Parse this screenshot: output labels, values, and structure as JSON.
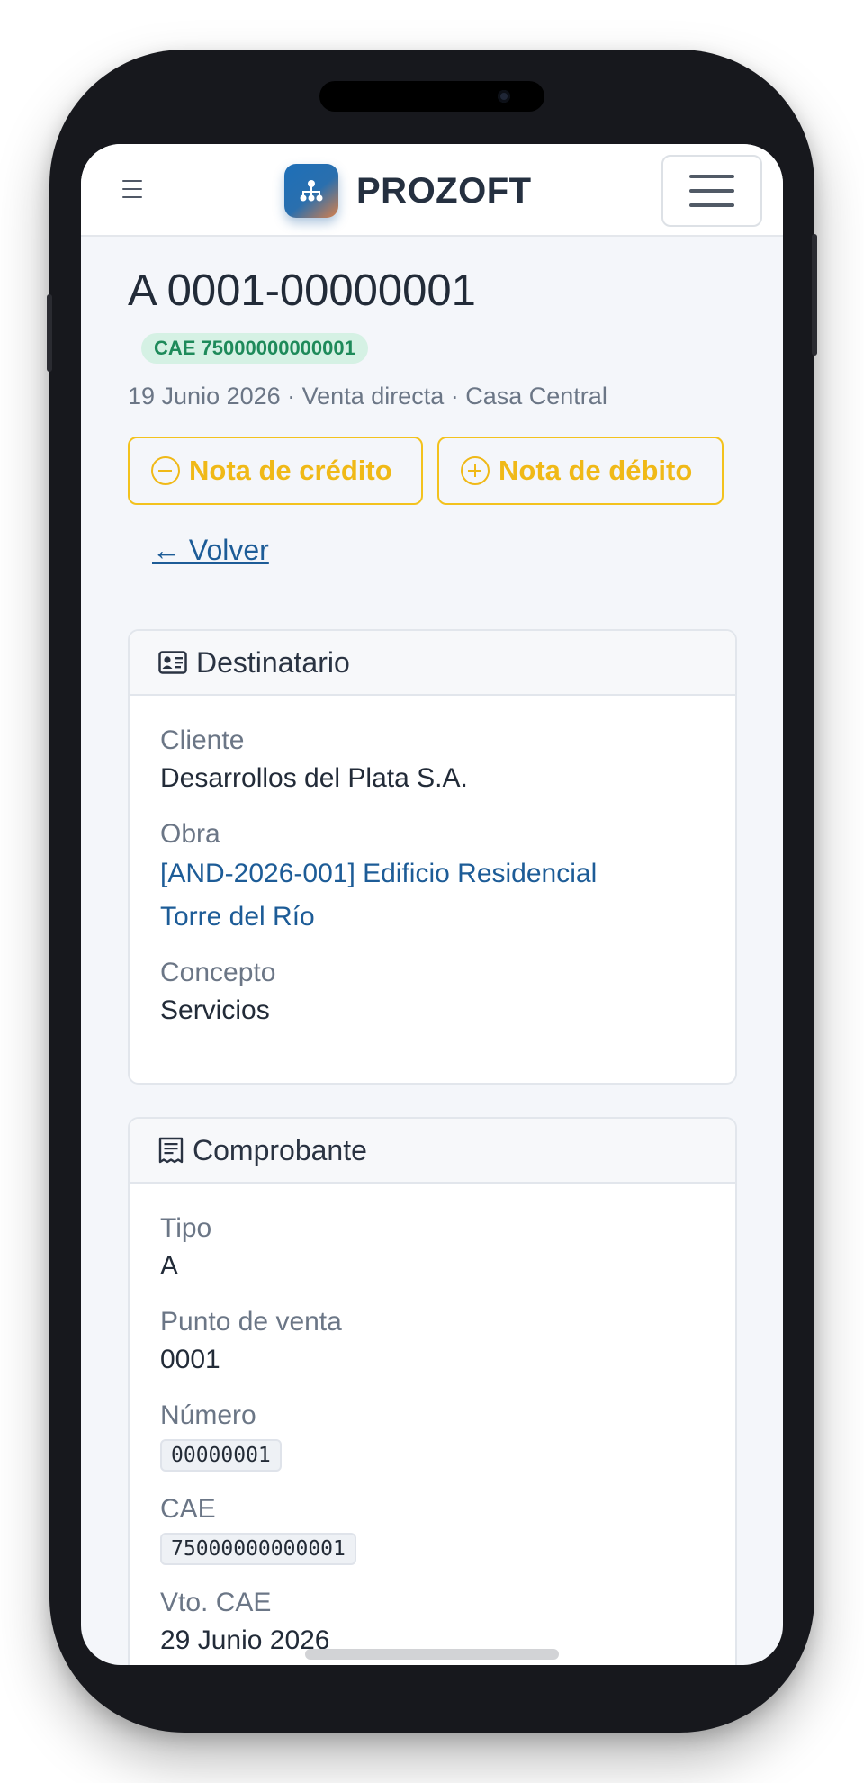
{
  "app": {
    "brand": "PROZOFT",
    "brand_color": "#1d6fb8"
  },
  "invoice": {
    "title": "A 0001-00000001",
    "cae_badge": "CAE 75000000000001",
    "meta": "19 Junio 2026 · Venta directa · Casa Central"
  },
  "actions": {
    "credit_note": "Nota de crédito",
    "debit_note": "Nota de débito",
    "back": "← Volver",
    "accent_color": "#f3c21d"
  },
  "recipient": {
    "heading": "Destinatario",
    "icon": "id-card-icon",
    "client_label": "Cliente",
    "client_value": "Desarrollos del Plata S.A.",
    "project_label": "Obra",
    "project_value_line1": "[AND-2026-001] Edificio Residencial",
    "project_value_line2": "Torre del Río",
    "concept_label": "Concepto",
    "concept_value": "Servicios"
  },
  "voucher": {
    "heading": "Comprobante",
    "icon": "receipt-icon",
    "type_label": "Tipo",
    "type_value": "A",
    "pos_label": "Punto de venta",
    "pos_value": "0001",
    "number_label": "Número",
    "number_value": "00000001",
    "cae_label": "CAE",
    "cae_value": "75000000000001",
    "cae_exp_label": "Vto. CAE",
    "cae_exp_value": "29 Junio 2026"
  }
}
